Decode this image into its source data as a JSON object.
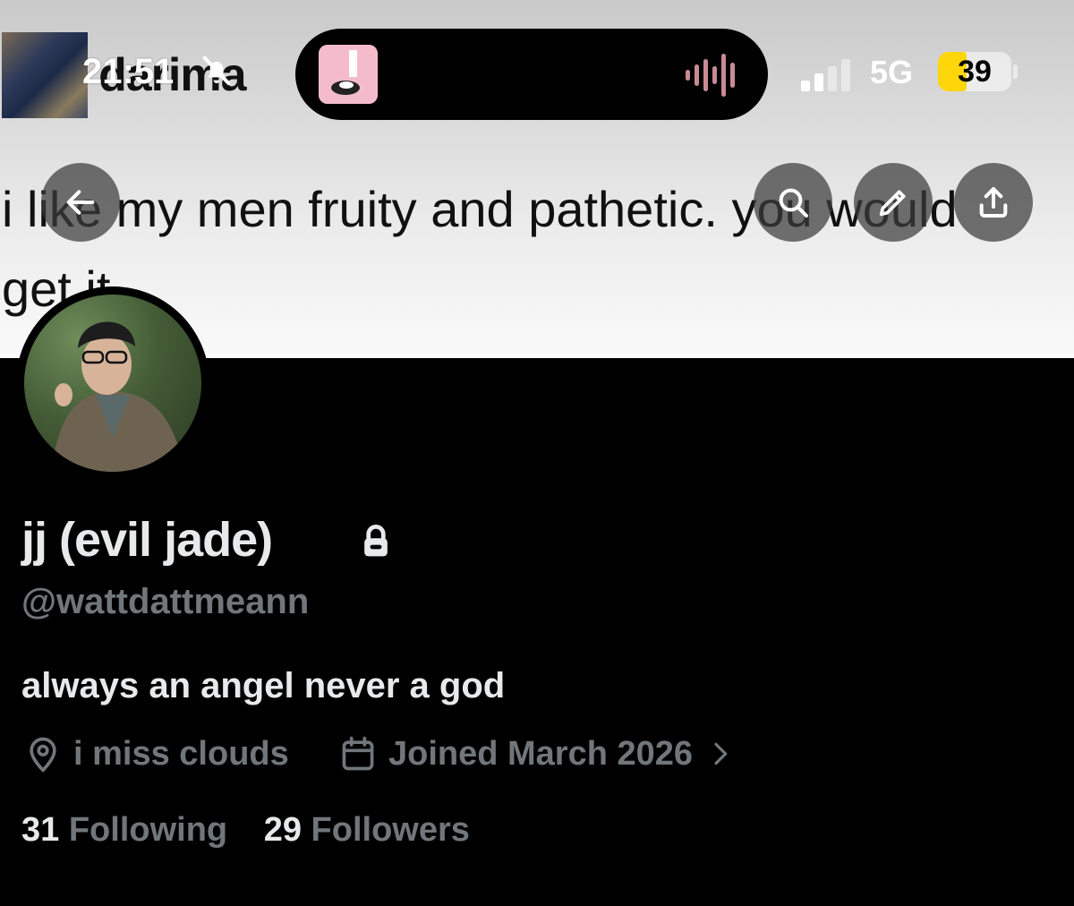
{
  "status_bar": {
    "time": "21:51",
    "network": "5G",
    "battery": "39",
    "battery_level": 0.39
  },
  "banner": {
    "header_name": "darima",
    "tweet_line1": "i like my men fruity and pathetic. you would",
    "tweet_line2": "get it"
  },
  "profile": {
    "display_name": "jj (evil jade)",
    "handle": "@wattdattmeann",
    "bio": "always an angel never a god",
    "location": "i miss clouds",
    "joined": "Joined March 2026",
    "following_count": "31",
    "following_label": "Following",
    "followers_count": "29",
    "followers_label": "Followers"
  },
  "icons": [
    "bell-slash-icon",
    "sound-wave-icon",
    "signal-icon",
    "back-arrow-icon",
    "search-icon",
    "pencil-icon",
    "share-icon",
    "lock-icon",
    "location-pin-icon",
    "calendar-icon",
    "chevron-right-icon"
  ],
  "colors": {
    "text_primary": "#e7e9ea",
    "text_secondary": "#71767b",
    "battery": "#ffd60a",
    "background": "#000000"
  }
}
